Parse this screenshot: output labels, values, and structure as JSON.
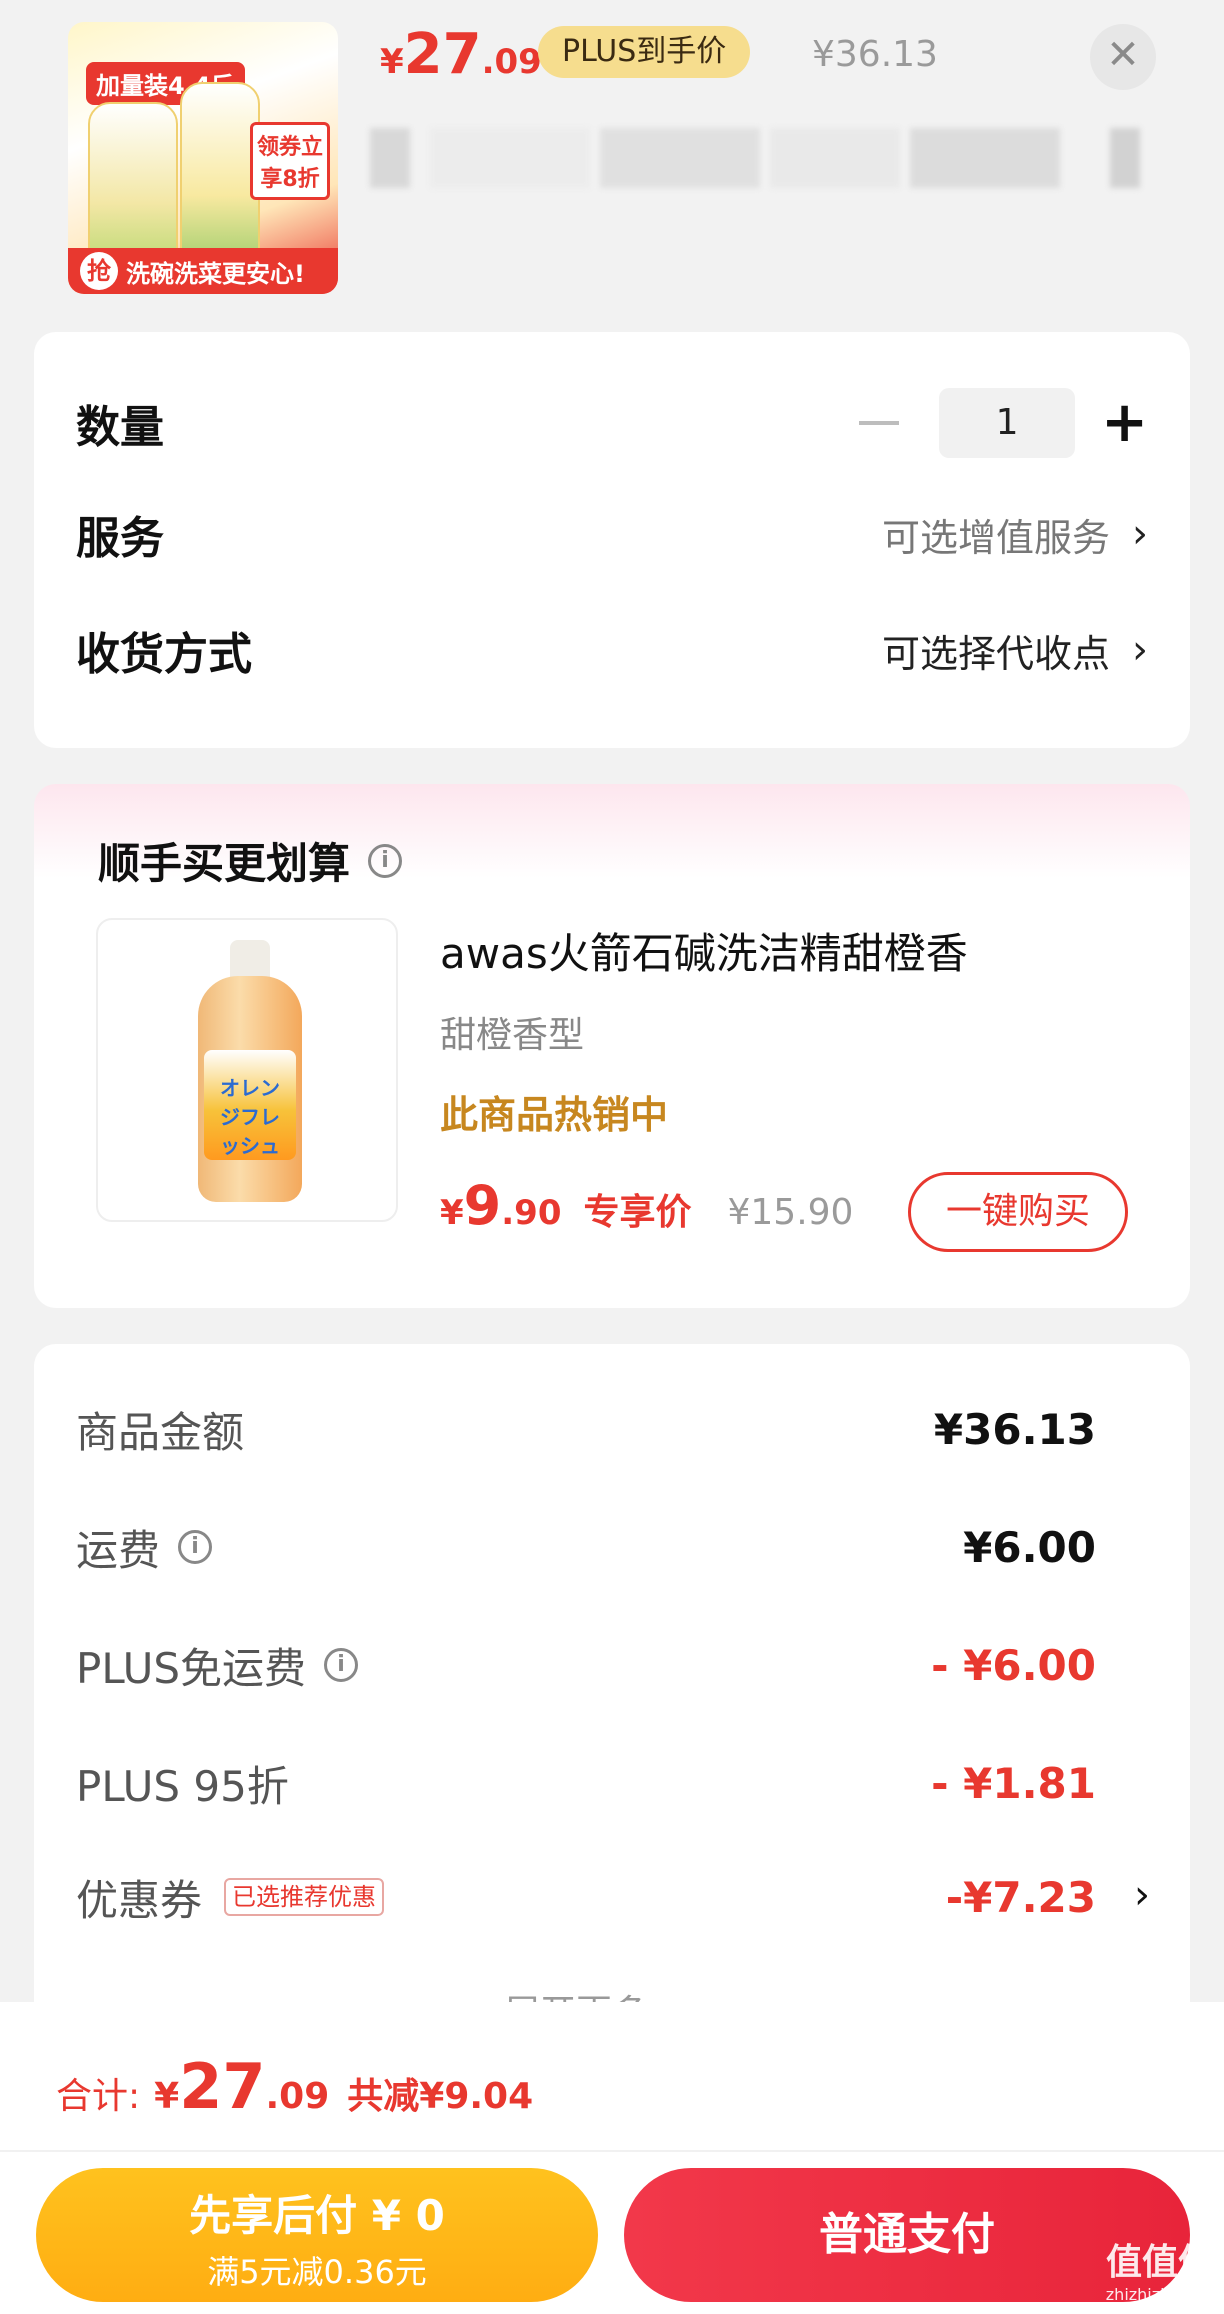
{
  "header": {
    "image_badge_top": "加量装4.4斤",
    "image_tag": "领券立享8折",
    "image_strip_icon": "抢",
    "image_strip_text": "洗碗洗菜更安心!",
    "price": {
      "currency": "¥",
      "integer": "27",
      "decimal": ".09"
    },
    "plus_badge": "PLUS到手价",
    "original_price": "¥36.13",
    "close_icon": "close-icon"
  },
  "options": {
    "quantity": {
      "label": "数量",
      "value": "1",
      "minus": "minus-icon",
      "plus": "+"
    },
    "service": {
      "label": "服务",
      "value": "可选增值服务",
      "chevron": "›"
    },
    "delivery": {
      "label": "收货方式",
      "value": "可选择代收点",
      "chevron": "›"
    }
  },
  "addon": {
    "title": "顺手买更划算",
    "info_icon": "i",
    "name": "awas火箭石碱洗洁精甜橙香",
    "spec": "甜橙香型",
    "hot": "此商品热销中",
    "price": {
      "currency": "¥",
      "integer": "9",
      "decimal": ".90"
    },
    "exclusive_label": "专享价",
    "original_price": "¥15.90",
    "buy_label": "一键购买",
    "image_label": "オレンジフレッシュ"
  },
  "summary": {
    "rows": [
      {
        "label": "商品金额",
        "value": "¥36.13"
      },
      {
        "label": "运费",
        "value": "¥6.00"
      },
      {
        "label": "PLUS免运费",
        "value": "- ¥6.00"
      },
      {
        "label": "PLUS 95折",
        "value": "- ¥1.81"
      },
      {
        "label": "优惠券",
        "value": "-¥7.23",
        "tag": "已选推荐优惠"
      }
    ],
    "more_label": "展开更多",
    "chevron": "›"
  },
  "footer": {
    "total_label": "合计:",
    "total": {
      "currency": "¥",
      "integer": "27",
      "decimal": ".09"
    },
    "saved": "共减¥9.04",
    "pay_later_title": "先享后付 ¥ 0",
    "pay_later_sub": "满5元减0.36元",
    "pay_normal": "普通支付",
    "watermark": "值值值",
    "watermark_url": "zhizhizhi.com"
  },
  "colors": {
    "accent": "#e8382f",
    "gold": "#ffb619",
    "plus_badge": "#f6dd8e"
  }
}
